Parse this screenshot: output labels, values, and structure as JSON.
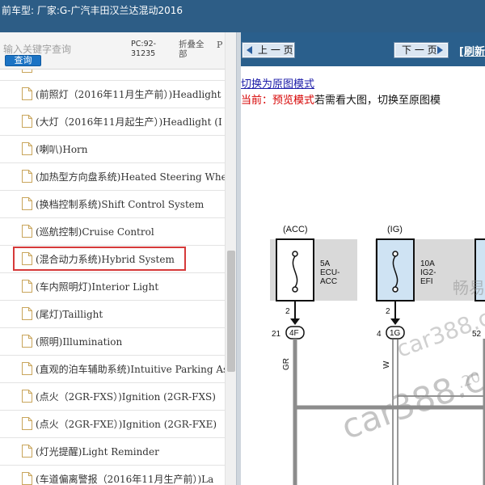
{
  "title_bar": {
    "text": "前车型:  厂家:G-广汽丰田汉兰达混动2016"
  },
  "search": {
    "placeholder": "输入关键字查询",
    "button_label": "查询",
    "pc_code": "PC:92-\n31235",
    "collapse_all": "折叠全\n部",
    "extra_col": "P"
  },
  "tree": {
    "items": [
      {
        "label": "(前照灯（2016年11月生产前）)Headlight",
        "highlighted": false
      },
      {
        "label": "(大灯（2016年11月起生产）)Headlight (I",
        "highlighted": false
      },
      {
        "label": "(喇叭)Horn",
        "highlighted": false
      },
      {
        "label": "(加热型方向盘系统)Heated Steering Whee",
        "highlighted": false
      },
      {
        "label": "(换档控制系统)Shift Control System",
        "highlighted": false
      },
      {
        "label": "(巡航控制)Cruise Control",
        "highlighted": false
      },
      {
        "label": "(混合动力系统)Hybrid System",
        "highlighted": true
      },
      {
        "label": "(车内照明灯)Interior Light",
        "highlighted": false
      },
      {
        "label": "(尾灯)Taillight",
        "highlighted": false
      },
      {
        "label": "(照明)Illumination",
        "highlighted": false
      },
      {
        "label": "(直观的泊车辅助系统)Intuitive Parking As",
        "highlighted": false
      },
      {
        "label": "(点火（2GR-FXS）)Ignition (2GR-FXS)",
        "highlighted": false
      },
      {
        "label": "(点火（2GR-FXE）)Ignition (2GR-FXE)",
        "highlighted": false
      },
      {
        "label": "(灯光提醒)Light Reminder",
        "highlighted": false
      },
      {
        "label": "(车道偏离警报（2016年11月生产前）)La",
        "highlighted": false
      }
    ]
  },
  "nav": {
    "prev_label": "上 一 页",
    "next_label": "下 一 页",
    "refresh_label": "[刷新"
  },
  "mode": {
    "switch_link": "切换为原图模式",
    "current_prefix": "当前：预览模式",
    "current_suffix": "若需看大图，切换至原图模"
  },
  "diagram": {
    "fuse_acc_label": "(ACC)",
    "fuse_ig_label": "(IG)",
    "fuse_5a_amp": "5A",
    "fuse_5a_l1": "ECU-",
    "fuse_5a_l2": "ACC",
    "fuse_10a_amp": "10A",
    "fuse_10a_l1": "IG2-",
    "fuse_10a_l2": "EFI",
    "pin_2a": "2",
    "pin_2b": "2",
    "conn_21": "21",
    "conn_4f": "4F",
    "conn_4": "4",
    "conn_1g": "1G",
    "conn_52": "52",
    "wire_gr": "GR",
    "wire_w": "W"
  },
  "watermarks": {
    "w1": "畅易",
    "w2": "car388.c",
    "w3": "car388.co",
    "w4": ".20"
  }
}
